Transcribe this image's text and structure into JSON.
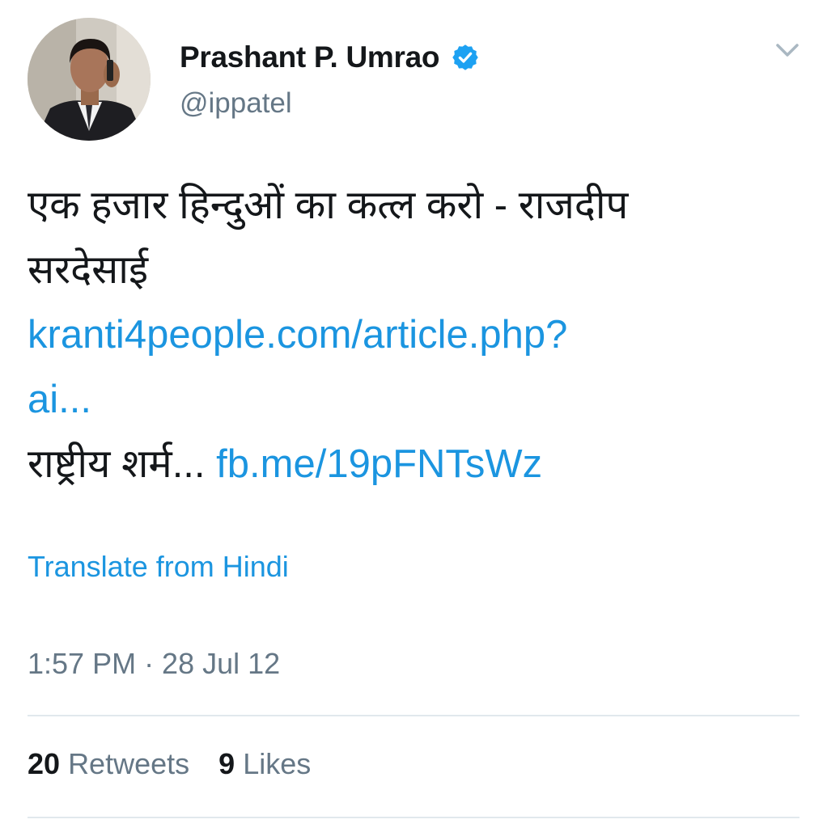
{
  "header": {
    "display_name": "Prashant P. Umrao",
    "handle": "@ippatel",
    "verified": true,
    "avatar_icon": "avatar-photo-man-on-phone",
    "menu_icon": "chevron-down-icon"
  },
  "tweet": {
    "line1": "एक हजार हिन्दुओं का कत्ल करो - राजदीप",
    "line2": "सरदेसाई",
    "link1_part1": "kranti4people.com/article.php?",
    "link1_part2": "ai...",
    "line5_text": "राष्ट्रीय शर्म... ",
    "link2": "fb.me/19pFNTsWz"
  },
  "translate_label": "Translate from Hindi",
  "timestamp": "1:57 PM · 28 Jul 12",
  "stats": {
    "retweets_count": "20",
    "retweets_label": "Retweets",
    "likes_count": "9",
    "likes_label": "Likes"
  },
  "colors": {
    "link": "#1b95e0",
    "text": "#14171a",
    "secondary": "#657786",
    "verified_badge": "#1da1f2",
    "divider": "#e1e8ed"
  }
}
